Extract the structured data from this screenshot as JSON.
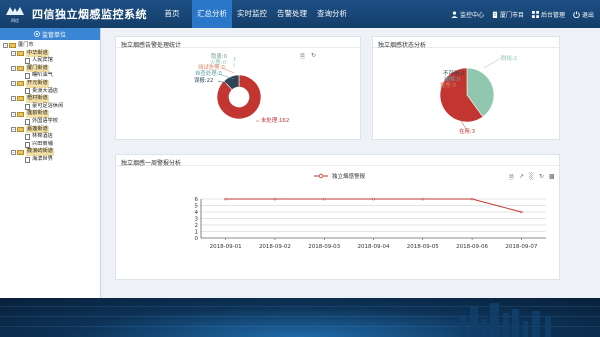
{
  "header": {
    "logo_sub": "四信",
    "title": "四信独立烟感监控系统",
    "nav": [
      "首页",
      "汇总分析",
      "实时监控",
      "告警处理",
      "查询分析"
    ],
    "active_nav": 1,
    "monitor_center": "监控中心",
    "region": "厦门市目",
    "admin": "后台管理",
    "logout": "退出"
  },
  "sidebar": {
    "title": "监管单位",
    "tree": [
      {
        "label": "厦门市",
        "level": 0,
        "type": "folder",
        "toggle": "-"
      },
      {
        "label": "中华街道",
        "level": 1,
        "type": "folder",
        "toggle": "-"
      },
      {
        "label": "人民宾馆",
        "level": 2,
        "type": "file"
      },
      {
        "label": "厦门街道",
        "level": 1,
        "type": "folder",
        "toggle": "-"
      },
      {
        "label": "曙叭油气",
        "level": 2,
        "type": "file"
      },
      {
        "label": "开元街道",
        "level": 1,
        "type": "folder",
        "toggle": "-"
      },
      {
        "label": "贵洲大酒店",
        "level": 2,
        "type": "file"
      },
      {
        "label": "梧村街道",
        "level": 1,
        "type": "folder",
        "toggle": "-"
      },
      {
        "label": "豪可足浴休闲",
        "level": 2,
        "type": "file"
      },
      {
        "label": "莲前街道",
        "level": 1,
        "type": "folder",
        "toggle": "-"
      },
      {
        "label": "外国语学校",
        "level": 2,
        "type": "file"
      },
      {
        "label": "嘉莲街道",
        "level": 1,
        "type": "folder",
        "toggle": "-"
      },
      {
        "label": "林棉酒店",
        "level": 2,
        "type": "file"
      },
      {
        "label": "兴田商埔",
        "level": 2,
        "type": "file"
      },
      {
        "label": "鼓浪屿街道",
        "level": 1,
        "type": "folder",
        "toggle": "-"
      },
      {
        "label": "海滨世界",
        "level": 2,
        "type": "file"
      }
    ]
  },
  "panels": {
    "alarm_stats_title": "独立烟感告警处理统计",
    "status_title": "独立烟感状态分析",
    "trend_title": "独立烟感一周警报分析"
  },
  "chart_data": [
    {
      "type": "pie",
      "title": "独立烟感告警处理统计",
      "slices": [
        {
          "label": "未处理",
          "value": 162,
          "color": "#c23531"
        },
        {
          "label": "误报",
          "value": 22,
          "color": "#2f4554"
        },
        {
          "label": "自查处理",
          "value": 0,
          "color": "#61a0a8"
        },
        {
          "label": "测试告警",
          "value": 0,
          "color": "#d48265"
        },
        {
          "label": "火警",
          "value": 0,
          "color": "#91c7ae"
        },
        {
          "label": "隐患",
          "value": 0,
          "color": "#749f83"
        }
      ],
      "labels_text": [
        "隐患:0",
        "火警:0",
        "测试告警:0",
        "自查处理:0",
        "误报:22",
        "未处理:162"
      ],
      "donut": true
    },
    {
      "type": "pie",
      "title": "独立烟感状态分析",
      "slices": [
        {
          "label": "在用",
          "value": 3,
          "color": "#c23531"
        },
        {
          "label": "报警",
          "value": 0,
          "color": "#d48265"
        },
        {
          "label": "故障",
          "value": 0,
          "color": "#61a0a8"
        },
        {
          "label": "不可用",
          "value": 0,
          "color": "#2f4554"
        },
        {
          "label": "脱线",
          "value": 2,
          "color": "#91c7ae"
        }
      ],
      "labels_text": [
        "不可用:0",
        "故障:0",
        "报警:0",
        "脱线:2",
        "在用:3"
      ],
      "donut": false
    },
    {
      "type": "line",
      "title": "独立烟感一周警报分析",
      "legend": "独立烟感警报",
      "x": [
        "2018-09-01",
        "2018-09-02",
        "2018-09-03",
        "2018-09-04",
        "2018-09-05",
        "2018-09-06",
        "2018-09-07"
      ],
      "series": [
        {
          "name": "独立烟感警报",
          "values": [
            6,
            6,
            6,
            6,
            6,
            6,
            4
          ],
          "color": "#c23531"
        }
      ],
      "ylim": [
        0,
        6
      ],
      "yticks": [
        0,
        1,
        2,
        3,
        4,
        5,
        6
      ]
    }
  ]
}
